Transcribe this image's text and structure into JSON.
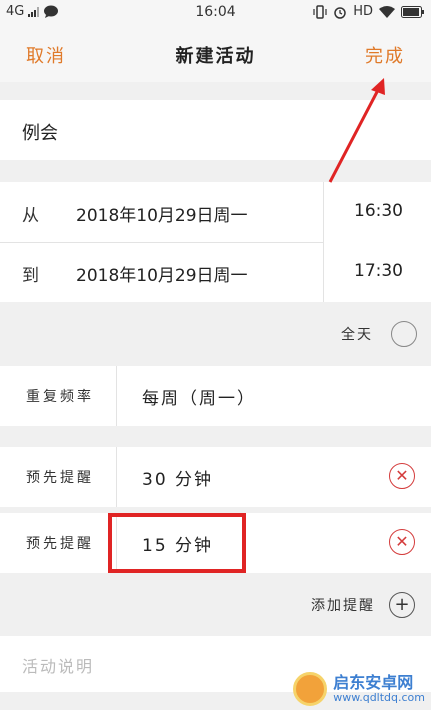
{
  "status_bar": {
    "network": "4G",
    "time": "16:04",
    "hd": "HD",
    "icons": [
      "signal-icon",
      "message-icon",
      "vibrate-icon",
      "alarm-icon",
      "wifi-icon",
      "battery-icon"
    ]
  },
  "nav": {
    "cancel": "取消",
    "title": "新建活动",
    "done": "完成",
    "accent_color": "#e07a2a"
  },
  "event_title": "例会",
  "time": {
    "from_label": "从",
    "from_date": "2018年10月29日周一",
    "from_time": "16:30",
    "to_label": "到",
    "to_date": "2018年10月29日周一",
    "to_time": "17:30"
  },
  "all_day": {
    "label": "全天",
    "checked": false
  },
  "repeat": {
    "label": "重复频率",
    "value": "每周（周一）"
  },
  "reminders": [
    {
      "label": "预先提醒",
      "value": "30 分钟",
      "remove_icon": "remove-icon"
    },
    {
      "label": "预先提醒",
      "value": "15 分钟",
      "remove_icon": "remove-icon"
    }
  ],
  "add_reminder": {
    "label": "添加提醒",
    "icon": "add-icon"
  },
  "description": {
    "placeholder": "活动说明"
  },
  "annotation": {
    "highlight_color": "#e02424"
  },
  "watermark": {
    "name": "启东安卓网",
    "url": "www.qdltdq.com"
  }
}
